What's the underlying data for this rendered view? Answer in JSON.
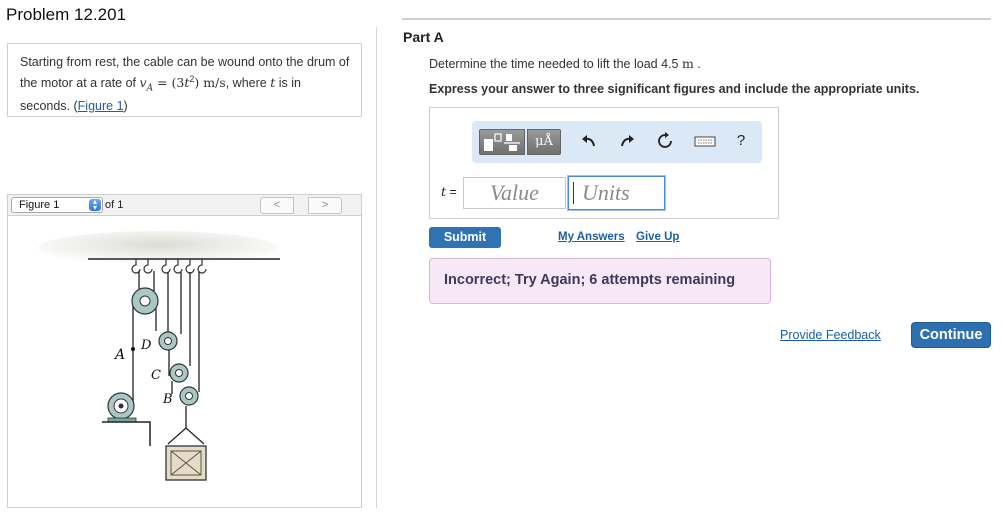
{
  "problem": {
    "title": "Problem 12.201",
    "text_1": "Starting from rest, the cable can be wound onto the drum of the motor at a rate of ",
    "math_va": "v",
    "math_va_sub": "A",
    "math_eq": " = (3",
    "math_t": "t",
    "math_exp": "2",
    "math_close": ") m/s",
    "text_2": ", where ",
    "text_t": "t",
    "text_3": " is in seconds. (",
    "figure_link": "Figure 1",
    "text_4": ")"
  },
  "figure": {
    "select_value": "Figure 1",
    "of_label": "of 1",
    "prev": "<",
    "next": ">",
    "labels": {
      "a": "A",
      "b": "B",
      "c": "C",
      "d": "D"
    }
  },
  "part": {
    "title": "Part A",
    "question_1": "Determine the time needed to lift the load 4.5 ",
    "question_unit": "m",
    "question_2": " .",
    "instruction": "Express your answer to three significant figures and include the appropriate units."
  },
  "toolbar": {
    "units_symbol": "μÅ",
    "help_symbol": "?"
  },
  "answer": {
    "variable": "t",
    "equals": " =",
    "value_placeholder": "Value",
    "units_placeholder": "Units"
  },
  "actions": {
    "submit": "Submit",
    "my_answers": "My Answers",
    "give_up": "Give Up",
    "feedback": "Incorrect; Try Again; 6 attempts remaining",
    "provide_feedback": "Provide Feedback",
    "continue": "Continue"
  },
  "colors": {
    "primary_button": "#2f73b5",
    "link": "#1a5fa8",
    "feedback_bg": "#f7e8f7",
    "toolbar_bg": "#dbe8f6"
  }
}
